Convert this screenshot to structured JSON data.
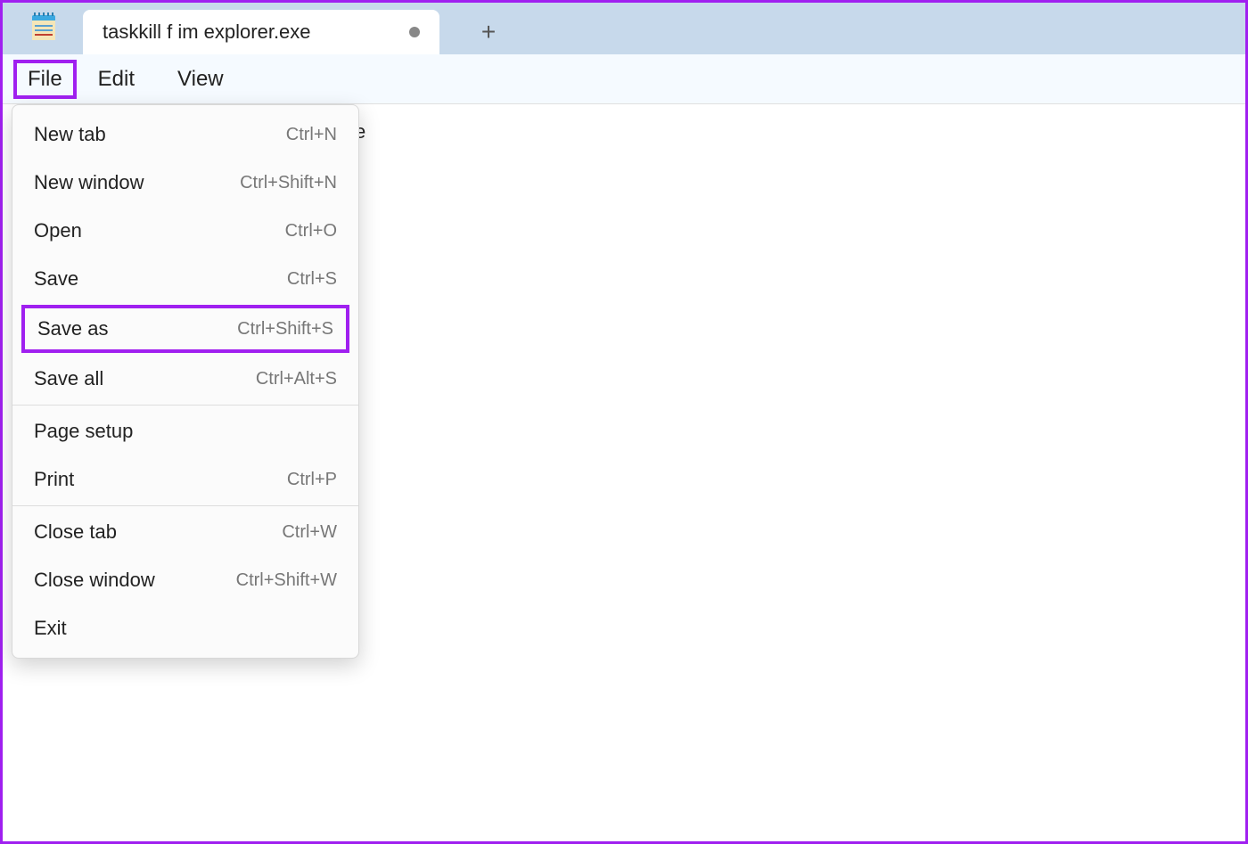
{
  "tab": {
    "title": "taskkill f im explorer.exe",
    "dirty": true
  },
  "menubar": {
    "file": "File",
    "edit": "Edit",
    "view": "View"
  },
  "editor": {
    "visible_tail": "e"
  },
  "file_menu": {
    "new_tab": {
      "label": "New tab",
      "shortcut": "Ctrl+N"
    },
    "new_window": {
      "label": "New window",
      "shortcut": "Ctrl+Shift+N"
    },
    "open": {
      "label": "Open",
      "shortcut": "Ctrl+O"
    },
    "save": {
      "label": "Save",
      "shortcut": "Ctrl+S"
    },
    "save_as": {
      "label": "Save as",
      "shortcut": "Ctrl+Shift+S"
    },
    "save_all": {
      "label": "Save all",
      "shortcut": "Ctrl+Alt+S"
    },
    "page_setup": {
      "label": "Page setup",
      "shortcut": ""
    },
    "print": {
      "label": "Print",
      "shortcut": "Ctrl+P"
    },
    "close_tab": {
      "label": "Close tab",
      "shortcut": "Ctrl+W"
    },
    "close_window": {
      "label": "Close window",
      "shortcut": "Ctrl+Shift+W"
    },
    "exit": {
      "label": "Exit",
      "shortcut": ""
    }
  },
  "highlights": {
    "annotation_color": "#a020f0"
  }
}
